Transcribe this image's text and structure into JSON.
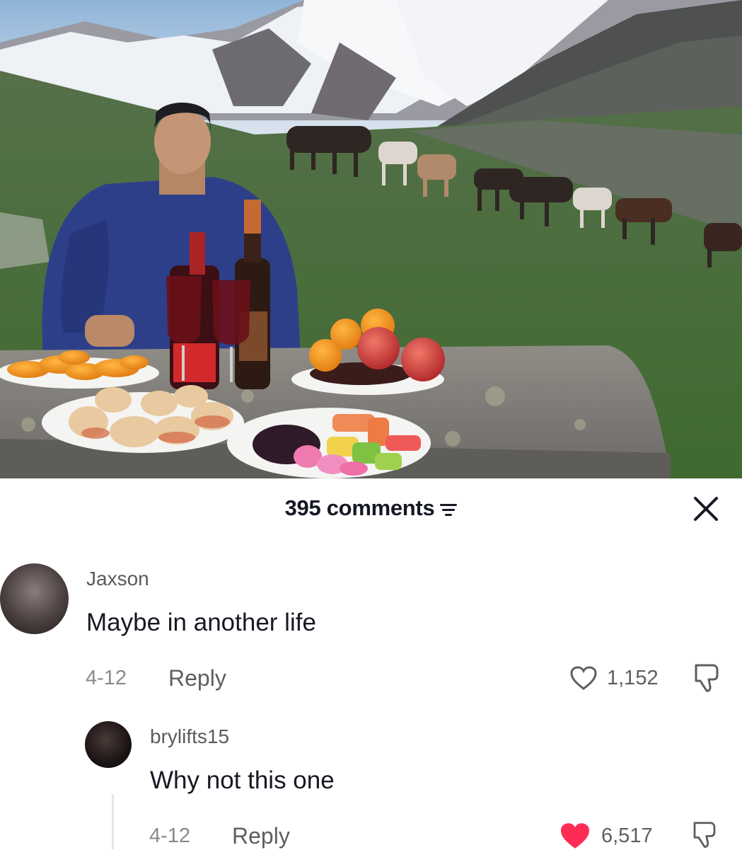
{
  "colors": {
    "like_red": "#fe2c55",
    "text_primary": "#161823",
    "text_secondary": "#8a8a8a"
  },
  "header": {
    "comment_count": "395 comments",
    "sort_icon": "sort-lines-icon",
    "close_icon": "close-x-icon"
  },
  "comments": [
    {
      "username": "Jaxson",
      "text": "Maybe in another life",
      "date": "4-12",
      "reply_label": "Reply",
      "likes": "1,152",
      "liked": false
    },
    {
      "username": "brylifts15",
      "text": "Why not this one",
      "date": "4-12",
      "reply_label": "Reply",
      "likes": "6,517",
      "liked": true
    }
  ]
}
